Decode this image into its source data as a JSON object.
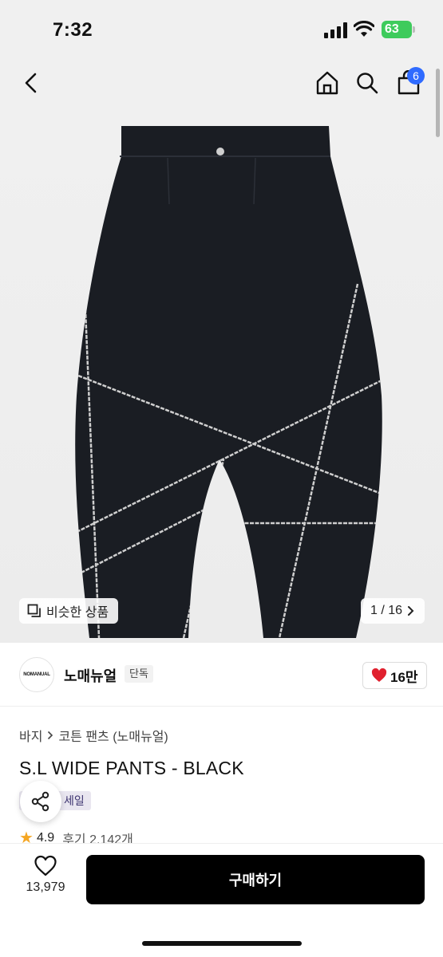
{
  "status_bar": {
    "time": "7:32",
    "battery": "63"
  },
  "header": {
    "cart_count": "6"
  },
  "gallery": {
    "similar_label": "비슷한 상품",
    "pager": "1 / 16"
  },
  "brand": {
    "name": "노매뉴얼",
    "tag": "단독",
    "likes": "16만",
    "logo_text": "NOMANUAL"
  },
  "breadcrumb": {
    "category": "바지",
    "subcategory": "코튼 팬츠 (노매뉴얼)"
  },
  "product": {
    "title": "S.L WIDE PANTS - BLACK",
    "sale_tag": "세일",
    "rating": "4.9",
    "review_label": "후기 2,142개"
  },
  "bottom_bar": {
    "wish_count": "13,979",
    "buy_label": "구매하기"
  },
  "colors": {
    "accent": "#2f6bff",
    "battery": "#3ecb5c",
    "heart": "#e0202e",
    "buy_button": "#000000"
  },
  "icons": [
    "back-icon",
    "home-icon",
    "search-icon",
    "cart-icon",
    "similar-icon",
    "chevron-right-icon",
    "heart-icon",
    "share-icon",
    "star-icon"
  ]
}
